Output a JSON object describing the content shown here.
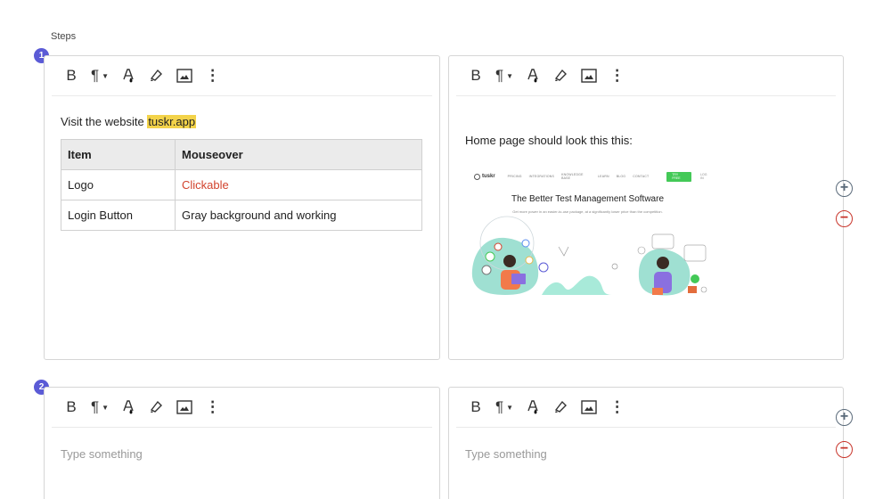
{
  "section_label": "Steps",
  "steps": [
    {
      "number": "1",
      "left": {
        "intro_text": "Visit the website ",
        "link_text": "tuskr.app",
        "table": {
          "headers": [
            "Item",
            "Mouseover"
          ],
          "rows": [
            [
              "Logo",
              "Clickable"
            ],
            [
              "Login Button",
              "Gray background and working"
            ]
          ]
        }
      },
      "right": {
        "text": "Home page should look this this:",
        "screenshot": {
          "logo": "tuskr",
          "nav_links": [
            "PRICING",
            "INTEGRATIONS",
            "KNOWLEDGE BASE",
            "LEARN",
            "BLOG",
            "CONTACT"
          ],
          "cta": "TRY FREE",
          "signin": "LOG IN",
          "headline": "The Better Test Management Software",
          "subheadline": "Get more power in an easier-to-use package, at a significantly lower price than the competition."
        }
      }
    },
    {
      "number": "2",
      "left": {
        "placeholder": "Type something"
      },
      "right": {
        "placeholder": "Type something"
      }
    }
  ],
  "toolbar": {
    "bold": "B",
    "paragraph": "¶",
    "caret": "▼",
    "more": "⋮"
  },
  "icons": {
    "add": "⊕",
    "remove": "⊖"
  },
  "colors": {
    "badge": "#5b5bd6",
    "highlight": "#f3d34a",
    "red_text": "#d2432d",
    "remove": "#c8342a",
    "cta_green": "#43c957"
  }
}
